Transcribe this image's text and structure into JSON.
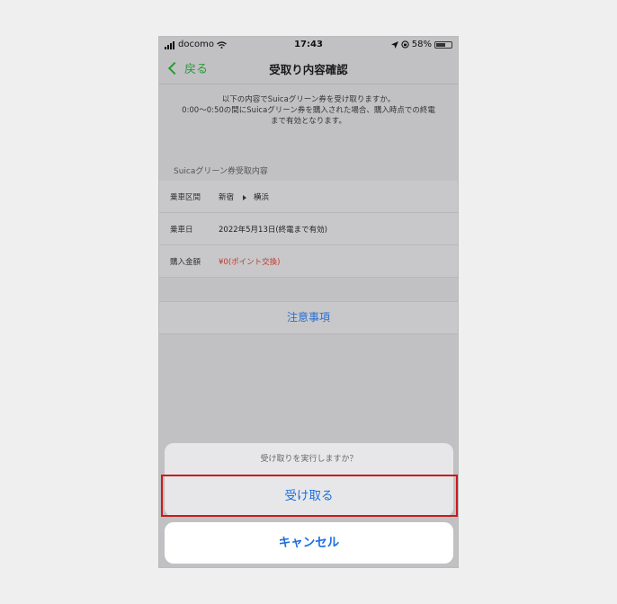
{
  "status_bar": {
    "carrier": "docomo",
    "time": "17:43",
    "battery": "58%",
    "battery_level": 0.58
  },
  "nav": {
    "back_label": "戻る",
    "title": "受取り内容確認"
  },
  "intro": {
    "line1": "以下の内容でSuicaグリーン券を受け取りますか。",
    "line2": "0:00〜0:50の間にSuicaグリーン券を購入された場合、購入時点での終電",
    "line3": "まで有効となります。"
  },
  "details": {
    "section_title": "Suicaグリーン券受取内容",
    "route_label": "乗車区間",
    "route_from": "新宿",
    "route_to": "横浜",
    "date_label": "乗車日",
    "date_value": "2022年5月13日(終電まで有効)",
    "amount_label": "購入金額",
    "amount_value": "¥0(ポイント交換)"
  },
  "notes_label": "注意事項",
  "action_sheet": {
    "prompt": "受け取りを実行しますか？",
    "confirm_label": "受け取る",
    "cancel_label": "キャンセル"
  },
  "colors": {
    "accent_green": "#2a9a3a",
    "action_blue": "#1a6fe0",
    "price_red": "#c0392b",
    "highlight_red": "#cc1a1a"
  }
}
